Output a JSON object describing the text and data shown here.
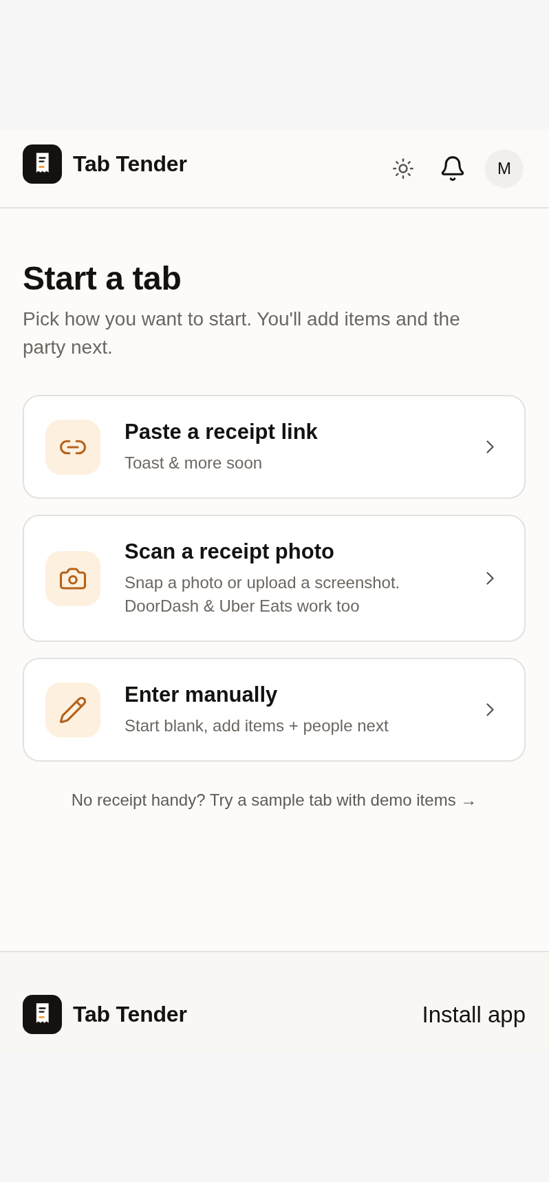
{
  "header": {
    "brand": "Tab Tender",
    "avatar": "M"
  },
  "intro": {
    "title": "Start a tab",
    "subtitle": "Pick how you want to start. You'll add items and the party next."
  },
  "options": [
    {
      "kind": "link",
      "title": "Paste a receipt link",
      "description": "Toast & more soon"
    },
    {
      "kind": "camera",
      "title": "Scan a receipt photo",
      "description": "Snap a photo or upload a screenshot. DoorDash & Uber Eats work too"
    },
    {
      "kind": "pencil",
      "title": "Enter manually",
      "description": "Start blank, add items + people next"
    }
  ],
  "sample_link": "No receipt handy? Try a sample tab with demo items →",
  "footer": {
    "brand": "Tab Tender",
    "install_link": "Install app"
  }
}
